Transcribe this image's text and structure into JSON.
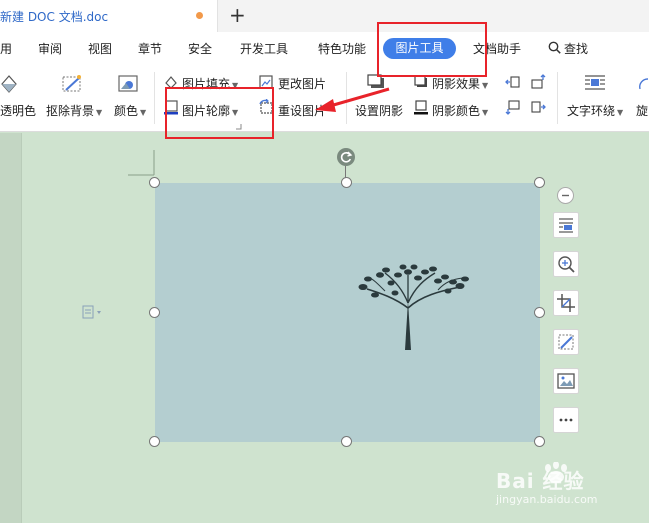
{
  "tabbar": {
    "doc_title": "新建 DOC 文档.doc",
    "new_tab_symbol": "+"
  },
  "menu": {
    "items": [
      "用",
      "审阅",
      "视图",
      "章节",
      "安全",
      "开发工具",
      "特色功能"
    ],
    "active": "图片工具",
    "doc_helper": "文档助手",
    "search": "查找"
  },
  "toolbar": {
    "transparent": "透明色",
    "cutout": "抠除背景",
    "color": "颜色",
    "fill": "图片填充",
    "outline": "图片轮廓",
    "change_picture": "更改图片",
    "reset": "重设图片",
    "shadow_effect": "阴影效果",
    "set_shadow": "设置阴影",
    "shadow_color": "阴影颜色",
    "text_wrap": "文字环绕",
    "rotate": "旋"
  },
  "colors": {
    "accent": "#3f7ee8",
    "highlight": "#e8232a",
    "page_bg": "#cfe3cf",
    "picture_bg": "#b4ced0"
  },
  "watermark": {
    "brand": "Bai 经验",
    "url": "jingyan.baidu.com"
  }
}
